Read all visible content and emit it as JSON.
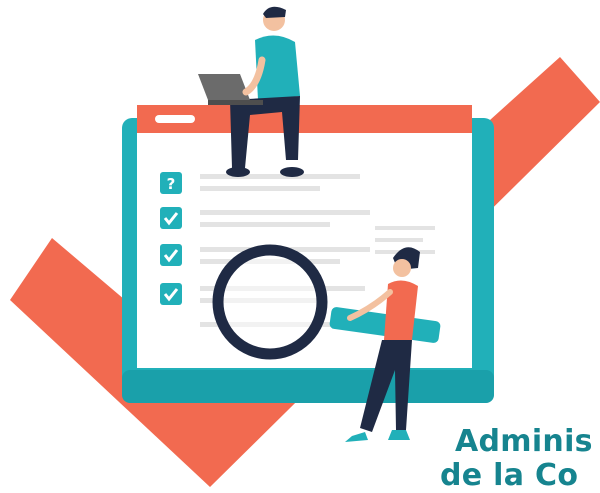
{
  "illustration": {
    "colors": {
      "accent_coral": "#f26a50",
      "teal": "#21b0b9",
      "teal_dark": "#158a93",
      "navy": "#1f2a44",
      "skin": "#f3c1a0",
      "window_bg": "#ffffff",
      "line_gray": "#e3e3e3"
    },
    "icons": [
      "question-mark-icon",
      "checkbox-checked-icon",
      "checkbox-checked-icon",
      "checkbox-checked-icon",
      "magnifying-glass-icon",
      "laptop-icon"
    ]
  },
  "caption": {
    "line1": "Adminis",
    "line2": "de la Co"
  }
}
